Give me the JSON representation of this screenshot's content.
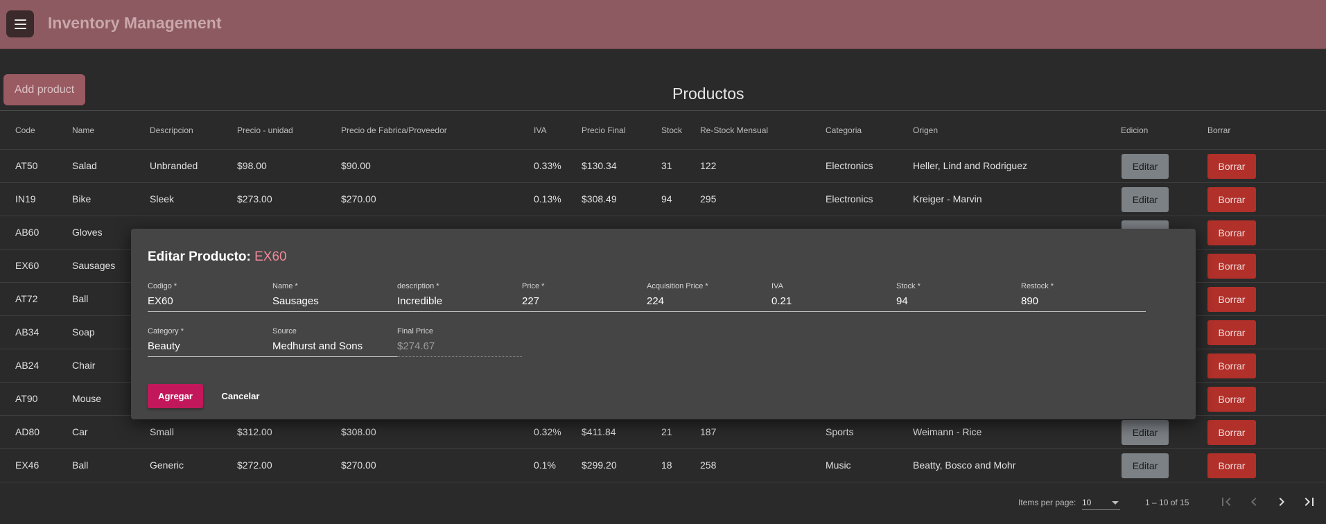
{
  "header": {
    "title": "Inventory Management",
    "menu_icon": "menu-icon"
  },
  "actions": {
    "add_product_label": "Add product"
  },
  "page": {
    "title": "Productos"
  },
  "table": {
    "columns": [
      "Code",
      "Name",
      "Descripcion",
      "Precio - unidad",
      "Precio de Fabrica/Proveedor",
      "IVA",
      "Precio Final",
      "Stock",
      "Re-Stock Mensual",
      "Categoria",
      "Origen",
      "Edicion",
      "Borrar"
    ],
    "edit_label": "Editar",
    "delete_label": "Borrar",
    "rows": [
      {
        "code": "AT50",
        "name": "Salad",
        "desc": "Unbranded",
        "price": "$98.00",
        "prov": "$90.00",
        "iva": "0.33%",
        "final": "$130.34",
        "stock": "31",
        "restock": "122",
        "cat": "Electronics",
        "orig": "Heller, Lind and Rodriguez"
      },
      {
        "code": "IN19",
        "name": "Bike",
        "desc": "Sleek",
        "price": "$273.00",
        "prov": "$270.00",
        "iva": "0.13%",
        "final": "$308.49",
        "stock": "94",
        "restock": "295",
        "cat": "Electronics",
        "orig": "Kreiger - Marvin"
      },
      {
        "code": "AB60",
        "name": "Gloves"
      },
      {
        "code": "EX60",
        "name": "Sausages"
      },
      {
        "code": "AT72",
        "name": "Ball"
      },
      {
        "code": "AB34",
        "name": "Soap"
      },
      {
        "code": "AB24",
        "name": "Chair"
      },
      {
        "code": "AT90",
        "name": "Mouse"
      },
      {
        "code": "AD80",
        "name": "Car",
        "desc": "Small",
        "price": "$312.00",
        "prov": "$308.00",
        "iva": "0.32%",
        "final": "$411.84",
        "stock": "21",
        "restock": "187",
        "cat": "Sports",
        "orig": "Weimann - Rice"
      },
      {
        "code": "EX46",
        "name": "Ball",
        "desc": "Generic",
        "price": "$272.00",
        "prov": "$270.00",
        "iva": "0.1%",
        "final": "$299.20",
        "stock": "18",
        "restock": "258",
        "cat": "Music",
        "orig": "Beatty, Bosco and Mohr"
      }
    ]
  },
  "paginator": {
    "items_per_page_label": "Items per page:",
    "items_per_page_value": "10",
    "range_label": "1 – 10 of 15"
  },
  "dialog": {
    "title_prefix": "Editar Producto:",
    "title_code": "EX60",
    "fields": {
      "codigo": {
        "label": "Codigo *",
        "value": "EX60"
      },
      "name": {
        "label": "Name *",
        "value": "Sausages"
      },
      "description": {
        "label": "description *",
        "value": "Incredible"
      },
      "price": {
        "label": "Price *",
        "value": "227"
      },
      "acq_price": {
        "label": "Acquisition Price *",
        "value": "224"
      },
      "iva": {
        "label": "IVA",
        "value": "0.21"
      },
      "stock": {
        "label": "Stock *",
        "value": "94"
      },
      "restock": {
        "label": "Restock *",
        "value": "890"
      },
      "category": {
        "label": "Category *",
        "value": "Beauty"
      },
      "source": {
        "label": "Source",
        "value": "Medhurst and Sons"
      },
      "final_price": {
        "label": "Final Price",
        "value": "$274.67"
      }
    },
    "submit_label": "Agregar",
    "cancel_label": "Cancelar"
  }
}
